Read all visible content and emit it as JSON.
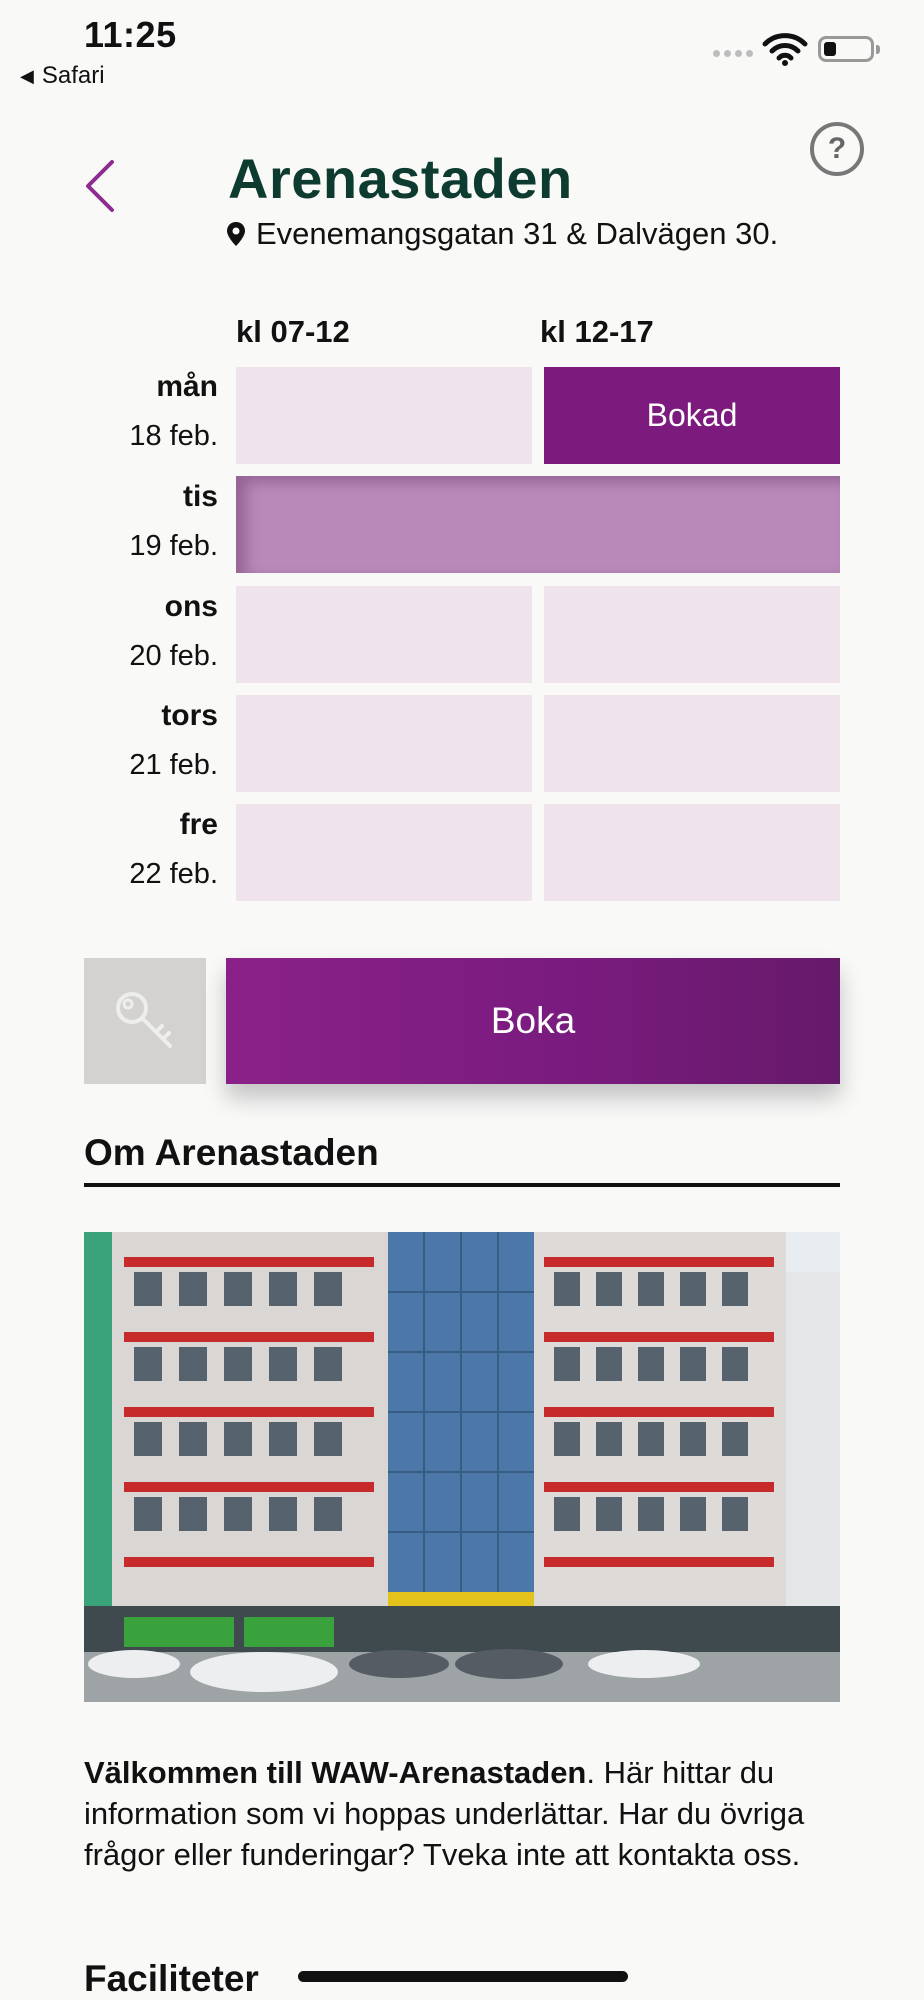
{
  "status_bar": {
    "time": "11:25",
    "back_app": "Safari"
  },
  "header": {
    "title": "Arenastaden",
    "address": "Evenemangsgatan 31 & Dalvägen 30.",
    "help_label": "?"
  },
  "schedule": {
    "columns": [
      "kl 07-12",
      "kl 12-17"
    ],
    "days": [
      {
        "name": "mån",
        "date": "18 feb.",
        "slots": [
          "",
          "Bokad"
        ]
      },
      {
        "name": "tis",
        "date": "19 feb."
      },
      {
        "name": "ons",
        "date": "20 feb."
      },
      {
        "name": "tors",
        "date": "21 feb."
      },
      {
        "name": "fre",
        "date": "22 feb."
      }
    ]
  },
  "actions": {
    "book_label": "Boka"
  },
  "about": {
    "title": "Om Arenastaden",
    "intro_bold": "Välkommen till WAW-Arenastaden",
    "intro_rest": ". Här hittar du information som vi hoppas underlättar. Har du övriga frågor eller funderingar? Tveka inte att kontakta oss."
  },
  "facilities": {
    "title": "Faciliteter"
  },
  "colors": {
    "accent": "#7d1a7e",
    "title": "#0e3b30",
    "slot_empty": "#efe3ec",
    "slot_selected": "#b98ab9"
  },
  "icons": [
    "back-chevron-icon",
    "help-icon",
    "location-pin-icon",
    "key-icon",
    "wifi-icon",
    "battery-icon"
  ]
}
